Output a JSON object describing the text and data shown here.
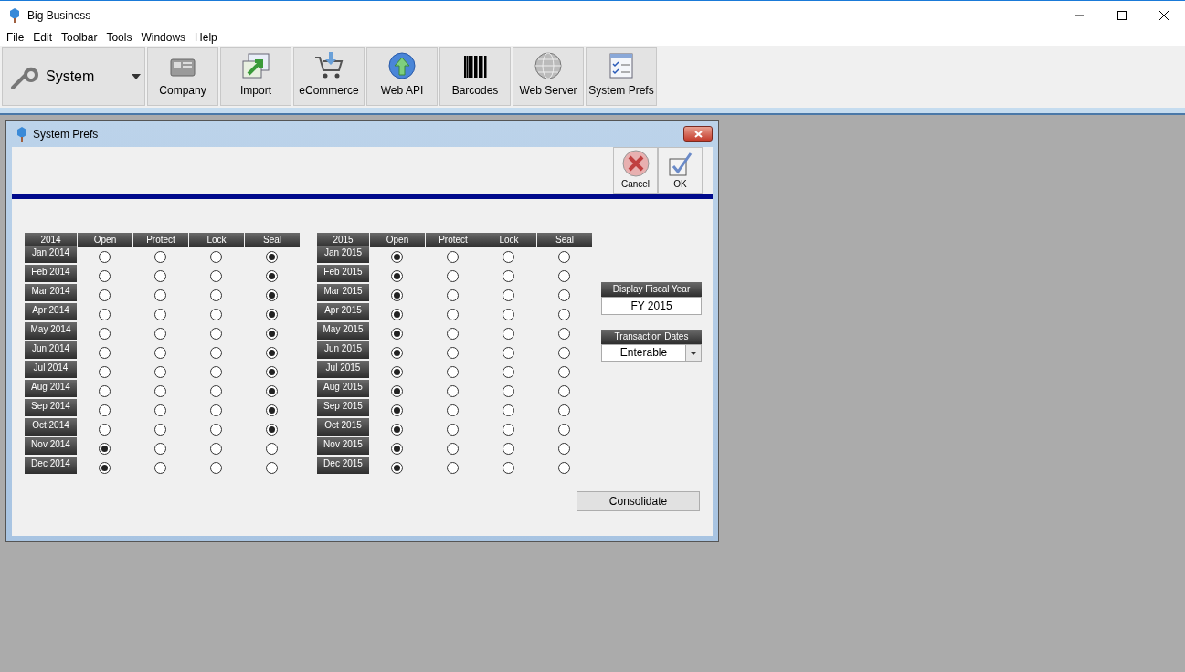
{
  "window": {
    "title": "Big Business"
  },
  "menu": [
    "File",
    "Edit",
    "Toolbar",
    "Tools",
    "Windows",
    "Help"
  ],
  "toolbar": {
    "module": "System",
    "buttons": [
      {
        "label": "Company",
        "kind": "folder"
      },
      {
        "label": "Import",
        "kind": "import"
      },
      {
        "label": "eCommerce",
        "kind": "cart"
      },
      {
        "label": "Web API",
        "kind": "api"
      },
      {
        "label": "Barcodes",
        "kind": "barcode"
      },
      {
        "label": "Web Server",
        "kind": "globe"
      },
      {
        "label": "System Prefs",
        "kind": "prefs"
      }
    ]
  },
  "dialog": {
    "title": "System Prefs",
    "actions": [
      {
        "label": "Cancel",
        "kind": "cancel"
      },
      {
        "label": "OK",
        "kind": "ok"
      }
    ],
    "years": [
      {
        "year": "2014",
        "columns": [
          "Open",
          "Protect",
          "Lock",
          "Seal"
        ],
        "months": [
          {
            "label": "Jan 2014",
            "radios": [
              {
                "selected": false
              },
              {
                "selected": false
              },
              {
                "selected": false
              },
              {
                "selected": true
              }
            ]
          },
          {
            "label": "Feb 2014",
            "radios": [
              {
                "selected": false
              },
              {
                "selected": false
              },
              {
                "selected": false
              },
              {
                "selected": true
              }
            ]
          },
          {
            "label": "Mar 2014",
            "radios": [
              {
                "selected": false
              },
              {
                "selected": false
              },
              {
                "selected": false
              },
              {
                "selected": true
              }
            ]
          },
          {
            "label": "Apr 2014",
            "radios": [
              {
                "selected": false
              },
              {
                "selected": false
              },
              {
                "selected": false
              },
              {
                "selected": true
              }
            ]
          },
          {
            "label": "May 2014",
            "radios": [
              {
                "selected": false
              },
              {
                "selected": false
              },
              {
                "selected": false
              },
              {
                "selected": true
              }
            ]
          },
          {
            "label": "Jun 2014",
            "radios": [
              {
                "selected": false
              },
              {
                "selected": false
              },
              {
                "selected": false
              },
              {
                "selected": true
              }
            ]
          },
          {
            "label": "Jul 2014",
            "radios": [
              {
                "selected": false
              },
              {
                "selected": false
              },
              {
                "selected": false
              },
              {
                "selected": true
              }
            ]
          },
          {
            "label": "Aug 2014",
            "radios": [
              {
                "selected": false
              },
              {
                "selected": false
              },
              {
                "selected": false
              },
              {
                "selected": true
              }
            ]
          },
          {
            "label": "Sep 2014",
            "radios": [
              {
                "selected": false
              },
              {
                "selected": false
              },
              {
                "selected": false
              },
              {
                "selected": true
              }
            ]
          },
          {
            "label": "Oct 2014",
            "radios": [
              {
                "selected": false
              },
              {
                "selected": false
              },
              {
                "selected": false
              },
              {
                "selected": true
              }
            ]
          },
          {
            "label": "Nov 2014",
            "radios": [
              {
                "selected": true
              },
              {
                "selected": false
              },
              {
                "selected": false
              },
              {
                "selected": false
              }
            ]
          },
          {
            "label": "Dec 2014",
            "radios": [
              {
                "selected": true
              },
              {
                "selected": false
              },
              {
                "selected": false
              },
              {
                "selected": false
              }
            ]
          }
        ]
      },
      {
        "year": "2015",
        "columns": [
          "Open",
          "Protect",
          "Lock",
          "Seal"
        ],
        "months": [
          {
            "label": "Jan 2015",
            "radios": [
              {
                "selected": true
              },
              {
                "selected": false
              },
              {
                "selected": false
              },
              {
                "selected": false
              }
            ]
          },
          {
            "label": "Feb 2015",
            "radios": [
              {
                "selected": true
              },
              {
                "selected": false
              },
              {
                "selected": false
              },
              {
                "selected": false
              }
            ]
          },
          {
            "label": "Mar 2015",
            "radios": [
              {
                "selected": true
              },
              {
                "selected": false
              },
              {
                "selected": false
              },
              {
                "selected": false
              }
            ]
          },
          {
            "label": "Apr 2015",
            "radios": [
              {
                "selected": true
              },
              {
                "selected": false
              },
              {
                "selected": false
              },
              {
                "selected": false
              }
            ]
          },
          {
            "label": "May 2015",
            "radios": [
              {
                "selected": true
              },
              {
                "selected": false
              },
              {
                "selected": false
              },
              {
                "selected": false
              }
            ]
          },
          {
            "label": "Jun 2015",
            "radios": [
              {
                "selected": true
              },
              {
                "selected": false
              },
              {
                "selected": false
              },
              {
                "selected": false
              }
            ]
          },
          {
            "label": "Jul 2015",
            "radios": [
              {
                "selected": true
              },
              {
                "selected": false
              },
              {
                "selected": false
              },
              {
                "selected": false
              }
            ]
          },
          {
            "label": "Aug 2015",
            "radios": [
              {
                "selected": true
              },
              {
                "selected": false
              },
              {
                "selected": false
              },
              {
                "selected": false
              }
            ]
          },
          {
            "label": "Sep 2015",
            "radios": [
              {
                "selected": true
              },
              {
                "selected": false
              },
              {
                "selected": false
              },
              {
                "selected": false
              }
            ]
          },
          {
            "label": "Oct 2015",
            "radios": [
              {
                "selected": true
              },
              {
                "selected": false
              },
              {
                "selected": false
              },
              {
                "selected": false
              }
            ]
          },
          {
            "label": "Nov 2015",
            "radios": [
              {
                "selected": true
              },
              {
                "selected": false
              },
              {
                "selected": false
              },
              {
                "selected": false
              }
            ]
          },
          {
            "label": "Dec 2015",
            "radios": [
              {
                "selected": true
              },
              {
                "selected": false
              },
              {
                "selected": false
              },
              {
                "selected": false
              }
            ]
          }
        ]
      }
    ],
    "fiscal_year": {
      "label": "Display Fiscal Year",
      "value": "FY 2015"
    },
    "transaction_dates": {
      "label": "Transaction Dates",
      "value": "Enterable"
    },
    "consolidate": "Consolidate"
  }
}
